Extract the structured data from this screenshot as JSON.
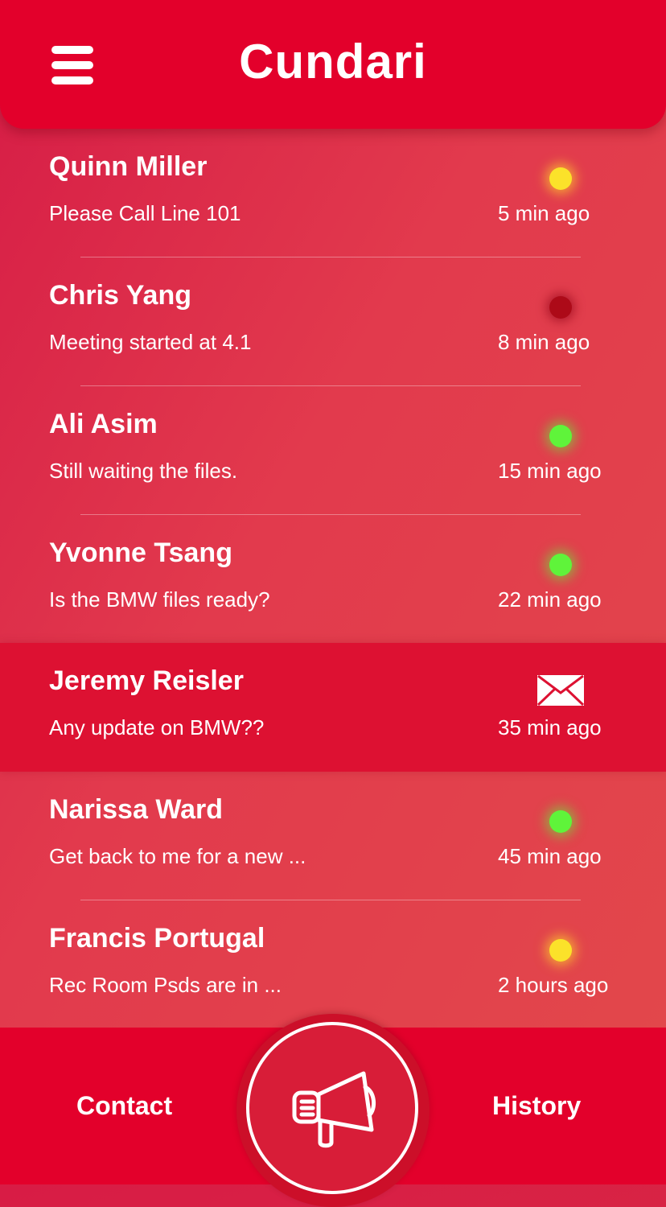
{
  "header": {
    "title": "Cundari",
    "menu_icon": "hamburger-menu-icon"
  },
  "contacts": [
    {
      "name": "Quinn Miller",
      "message": "Please Call Line 101",
      "time": "5 min ago",
      "status": "yellow",
      "status_color": "#fbe22a"
    },
    {
      "name": "Chris Yang",
      "message": "Meeting started at 4.1",
      "time": "8 min ago",
      "status": "red",
      "status_color": "#ad0a18"
    },
    {
      "name": "Ali Asim",
      "message": "Still waiting the files.",
      "time": "15 min ago",
      "status": "green",
      "status_color": "#5ff43a"
    },
    {
      "name": "Yvonne Tsang",
      "message": "Is the BMW files ready?",
      "time": "22 min ago",
      "status": "green",
      "status_color": "#5ff43a"
    },
    {
      "name": "Jeremy Reisler",
      "message": "Any update on BMW??",
      "time": "35 min ago",
      "status": "unread",
      "status_icon": "envelope-icon"
    },
    {
      "name": "Narissa Ward",
      "message": "Get back to me for a new ...",
      "time": "45 min ago",
      "status": "green",
      "status_color": "#5ff43a"
    },
    {
      "name": "Francis Portugal",
      "message": "Rec Room Psds are in ...",
      "time": "2 hours ago",
      "status": "yellow",
      "status_color": "#fbe22a"
    }
  ],
  "bottom_nav": {
    "left_label": "Contact",
    "right_label": "History",
    "center_icon": "megaphone-icon"
  },
  "colors": {
    "brand_red": "#e3002b",
    "highlight_row": "#dd1132"
  }
}
